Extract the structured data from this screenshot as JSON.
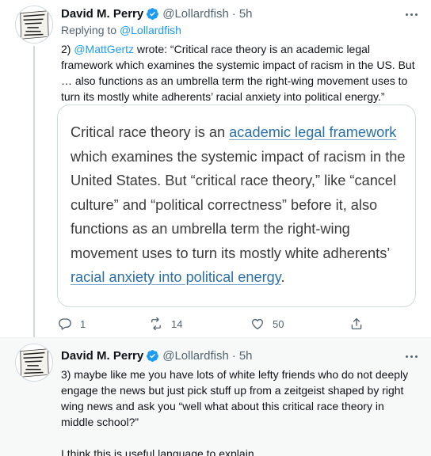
{
  "tweets": [
    {
      "author_name": "David M. Perry",
      "handle": "@Lollardfish",
      "separator": "·",
      "time": "5h",
      "replying_prefix": "Replying to",
      "replying_to": "@Lollardfish",
      "text_prefix": "2)",
      "text_mention": "@MattGertz",
      "text_body": " wrote: “Critical race theory is an academic legal framework which examines the systemic impact of racism in the US. But … also functions as an umbrella term the right-wing movement uses to turn its mostly white adherents’ racial anxiety into political energy.”",
      "quote": {
        "part1": "Critical race theory is an ",
        "link1": "academic legal framework",
        "part2": " which examines the systemic impact of racism in the United States. But “critical race theory,” like “cancel culture” and “political correctness” before it, also functions as an umbrella term the right-wing movement uses to turn its mostly white adherents’ ",
        "link2": "racial anxiety into political energy",
        "part3": "."
      },
      "actions": {
        "reply_count": "1",
        "retweet_count": "14",
        "like_count": "50"
      }
    },
    {
      "author_name": "David M. Perry",
      "handle": "@Lollardfish",
      "separator": "·",
      "time": "5h",
      "text_para1": "3) maybe like me you have lots of white lefty friends who do not deeply engage the news but just pick stuff up from a zeitgeist shaped by right wing news and ask you “well what about this critical race theory in middle school?”",
      "text_para2": "I think this is useful language to explain."
    }
  ],
  "avatar_lines": [
    "IT'S MIDTERM",
    "SATCHEL. WHY",
    "SOME FEEL",
    "GOOD",
    "DAVY",
    "TALK SO"
  ],
  "icons": {
    "verified": "verified-badge-icon",
    "more": "more-options-icon",
    "reply": "reply-icon",
    "retweet": "retweet-icon",
    "like": "heart-icon",
    "share": "share-icon"
  },
  "colors": {
    "accent": "#1d9bf0",
    "secondary_text": "#536471",
    "quote_link": "#2a6fa8",
    "second_tweet_bg": "#f7f9f9"
  }
}
